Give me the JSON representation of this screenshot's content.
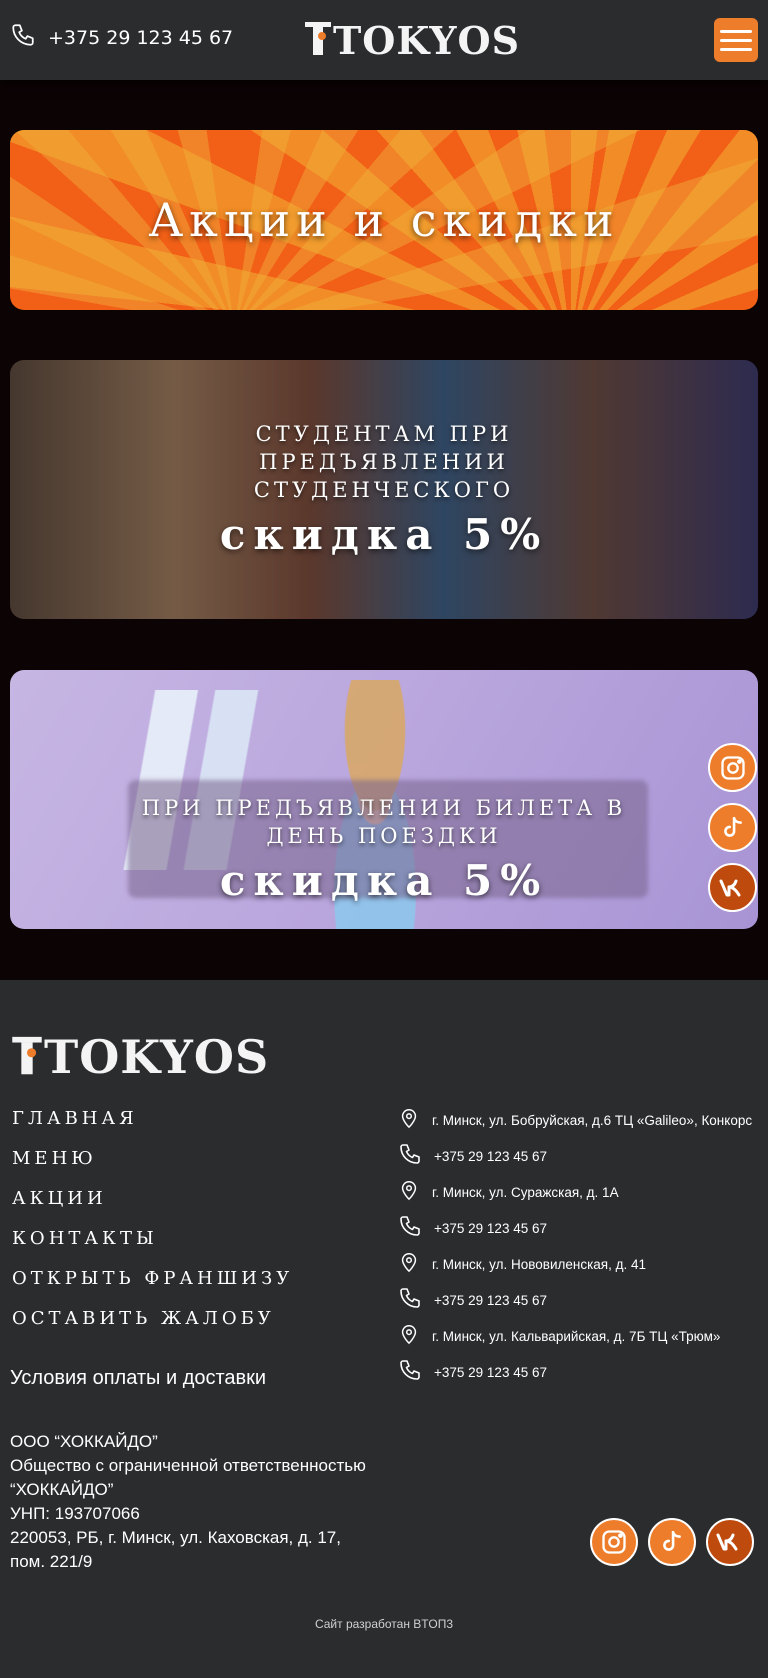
{
  "header": {
    "phone": "+375 29 123 45 67",
    "logo": "TOKYOS",
    "phone_icon": "phone-icon",
    "menu_icon": "hamburger-menu-icon"
  },
  "banners": [
    {
      "title": "Акции и скидки"
    },
    {
      "subtitle": "Студентам при предъявлении студенческого",
      "big": "скидка 5%"
    },
    {
      "subtitle": "При предъявлении билета в день поездки",
      "big": "скидка 5%"
    }
  ],
  "social": [
    "instagram-icon",
    "tiktok-icon",
    "vk-icon"
  ],
  "footer": {
    "logo": "TOKYOS",
    "nav": [
      "Главная",
      "Меню",
      "Акции",
      "Контакты",
      "Открыть франшизу",
      "Оставить жалобу"
    ],
    "payment_link": "Условия оплаты и доставки",
    "company": {
      "line1": "ООО “ХОККАЙДО”",
      "line2": "Общество с ограниченной ответственностью “ХОККАЙДО”",
      "line3": "УНП: 193707066",
      "line4": "220053, РБ, г. Минск, ул. Каховская, д. 17, пом. 221/9"
    },
    "contacts": [
      {
        "type": "address",
        "text": "г. Минск, ул. Бобруйская, д.6 ТЦ «Galileo», Конкорс"
      },
      {
        "type": "phone",
        "text": "+375 29 123 45 67"
      },
      {
        "type": "address",
        "text": "г. Минск, ул. Суражская, д. 1А"
      },
      {
        "type": "phone",
        "text": "+375 29 123 45 67"
      },
      {
        "type": "address",
        "text": "г. Минск, ул. Нововиленская, д. 41"
      },
      {
        "type": "phone",
        "text": "+375 29 123 45 67"
      },
      {
        "type": "address",
        "text": "г. Минск, ул. Кальварийская, д. 7Б ТЦ «Трюм»"
      },
      {
        "type": "phone",
        "text": "+375 29 123 45 67"
      }
    ],
    "credit": "Сайт разработан BTOП3"
  },
  "colors": {
    "accent": "#ee7d2b",
    "header_bg": "#2b2c2e",
    "page_bg": "#0c0305"
  }
}
